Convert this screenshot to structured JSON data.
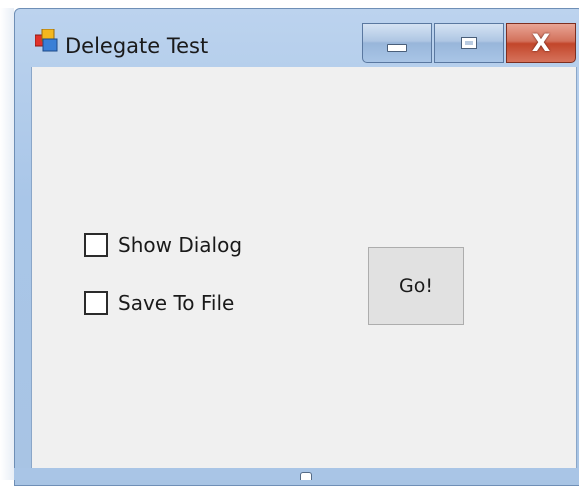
{
  "window": {
    "title": "Delegate Test",
    "app_icon": "windows-forms-app-icon",
    "caption_buttons": {
      "minimize_icon": "minimize-icon",
      "maximize_icon": "maximize-icon",
      "close_glyph": "X"
    }
  },
  "form": {
    "checkboxes": [
      {
        "label": "Show Dialog",
        "checked": false
      },
      {
        "label": "Save To File",
        "checked": false
      }
    ],
    "go_button_label": "Go!"
  },
  "colors": {
    "title_bar": "#a9c6e8",
    "close_button": "#c2462a",
    "client_background": "#f0f0f0",
    "button_face": "#e1e1e1"
  }
}
